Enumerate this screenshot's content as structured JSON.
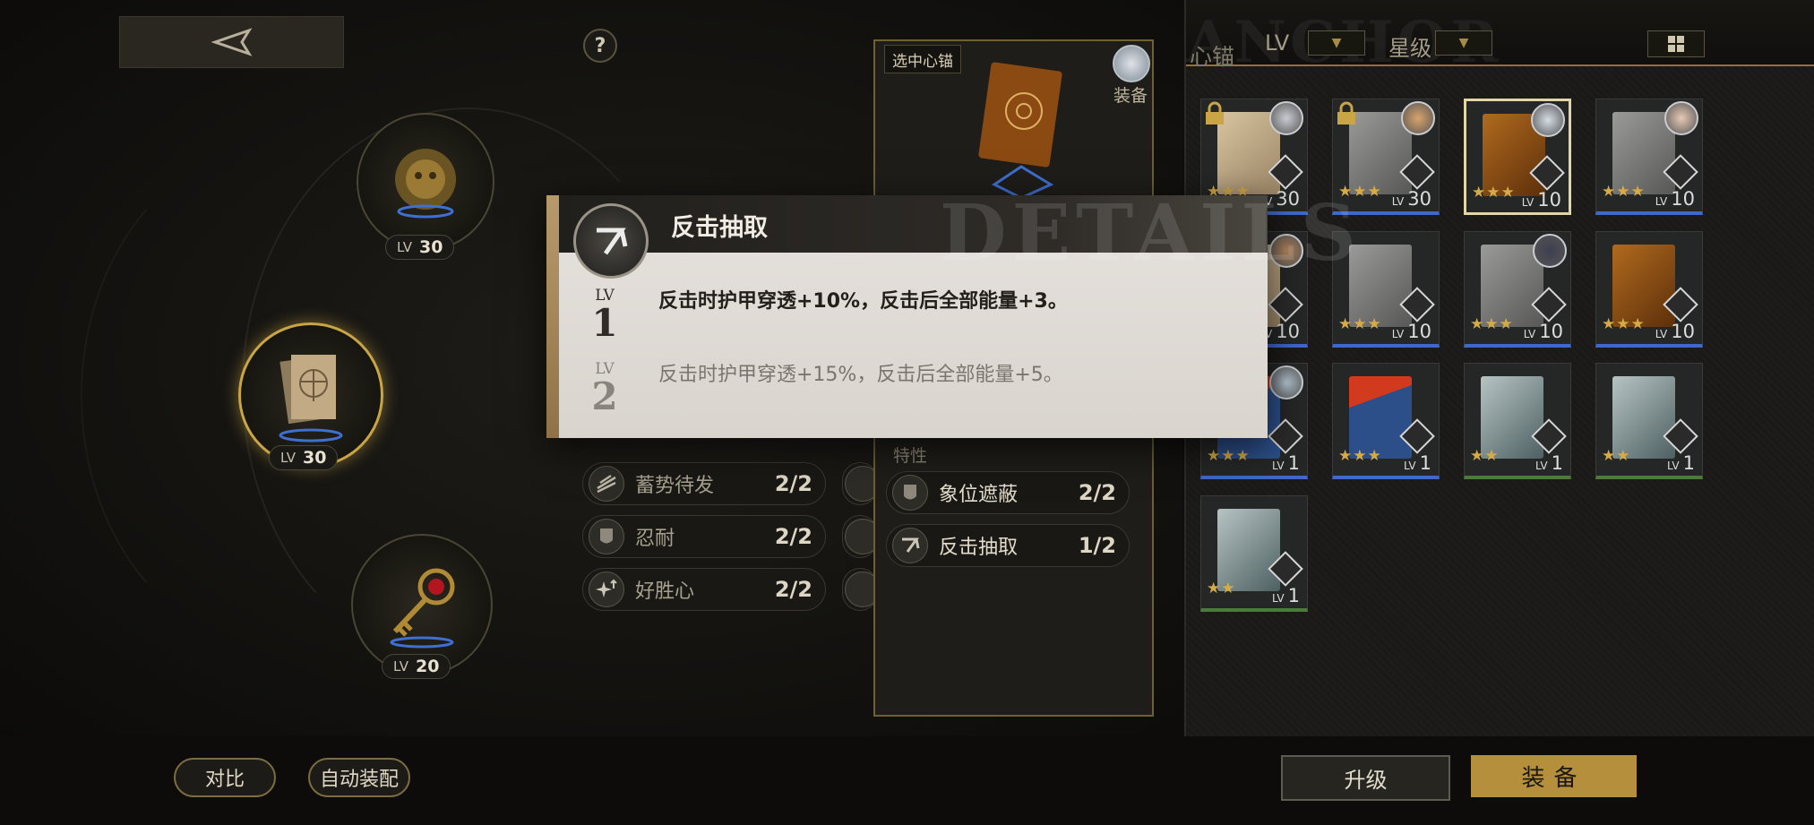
{
  "header": {
    "help_symbol": "?"
  },
  "equipped_slots": [
    {
      "lv_label": "LV",
      "lv": "30"
    },
    {
      "lv_label": "LV",
      "lv": "30"
    },
    {
      "lv_label": "LV",
      "lv": "20"
    }
  ],
  "skills_left": [
    {
      "name": "蓄势待发",
      "count": "2/2"
    },
    {
      "name": "忍耐",
      "count": "2/2"
    },
    {
      "name": "好胜心",
      "count": "2/2"
    }
  ],
  "detail_card": {
    "selected_label": "选中心锚",
    "equip_status": "装备",
    "trait_title": "特性",
    "traits": [
      {
        "name": "象位遮蔽",
        "count": "2/2"
      },
      {
        "name": "反击抽取",
        "count": "1/2"
      }
    ]
  },
  "tooltip": {
    "title": "反击抽取",
    "watermark": "DETAILS",
    "levels": [
      {
        "lv_label": "LV",
        "level": "1",
        "description": "反击时护甲穿透+10%，反击后全部能量+3。",
        "active": true
      },
      {
        "lv_label": "LV",
        "level": "2",
        "description": "反击时护甲穿透+15%，反击后全部能量+5。",
        "active": false
      }
    ]
  },
  "inventory": {
    "watermark": "ANCHOR",
    "title": "心锚",
    "filter_lv": "LV",
    "filter_star": "星级",
    "cards": [
      {
        "art": "paper",
        "lv_label": "LV",
        "lv": "30",
        "stars": "★★★",
        "locked": true,
        "avatar": "#c8ccd2",
        "rarity": "blue",
        "selected": false
      },
      {
        "art": "gray",
        "lv_label": "LV",
        "lv": "30",
        "stars": "★★★",
        "locked": true,
        "avatar": "#d9a46b",
        "rarity": "blue",
        "selected": false
      },
      {
        "art": "brown",
        "lv_label": "LV",
        "lv": "10",
        "stars": "★★★",
        "locked": false,
        "avatar": "#d5dde6",
        "rarity": "none",
        "selected": true
      },
      {
        "art": "gray",
        "lv_label": "LV",
        "lv": "10",
        "stars": "★★★",
        "locked": false,
        "avatar": "#e7c9b5",
        "rarity": "blue",
        "selected": false
      },
      {
        "art": "paper",
        "lv_label": "LV",
        "lv": "10",
        "stars": "★★★",
        "locked": false,
        "avatar": "#b7855a",
        "rarity": "blue",
        "selected": false
      },
      {
        "art": "gray",
        "lv_label": "LV",
        "lv": "10",
        "stars": "★★★",
        "locked": false,
        "avatar": "",
        "rarity": "blue",
        "selected": false
      },
      {
        "art": "gray",
        "lv_label": "LV",
        "lv": "10",
        "stars": "★★★",
        "locked": false,
        "avatar": "#3d3f50",
        "rarity": "blue",
        "selected": false
      },
      {
        "art": "brown",
        "lv_label": "LV",
        "lv": "10",
        "stars": "★★★",
        "locked": false,
        "avatar": "",
        "rarity": "blue",
        "selected": false
      },
      {
        "art": "magazine",
        "lv_label": "LV",
        "lv": "1",
        "stars": "★★★",
        "locked": false,
        "avatar": "#b7c7d4",
        "rarity": "blue",
        "selected": false
      },
      {
        "art": "magazine",
        "lv_label": "LV",
        "lv": "1",
        "stars": "★★★",
        "locked": false,
        "avatar": "",
        "rarity": "blue",
        "selected": false
      },
      {
        "art": "green",
        "lv_label": "LV",
        "lv": "1",
        "stars": "★★",
        "locked": false,
        "avatar": "",
        "rarity": "green",
        "selected": false
      },
      {
        "art": "green",
        "lv_label": "LV",
        "lv": "1",
        "stars": "★★",
        "locked": false,
        "avatar": "",
        "rarity": "green",
        "selected": false
      },
      {
        "art": "green",
        "lv_label": "LV",
        "lv": "1",
        "stars": "★★",
        "locked": false,
        "avatar": "",
        "rarity": "green",
        "selected": false
      }
    ]
  },
  "bottom_bar": {
    "compare": "对比",
    "auto_equip": "自动装配",
    "upgrade": "升级",
    "equip": "装备"
  },
  "colors": {
    "accent_gold": "#b58f3c",
    "rarity_blue": "#3e68c9",
    "rarity_green": "#4b7b3a"
  }
}
